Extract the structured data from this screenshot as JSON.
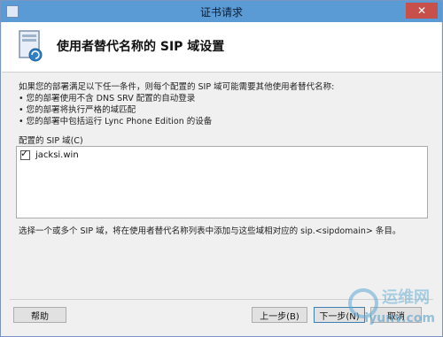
{
  "window": {
    "title": "证书请求",
    "close_label": "✕"
  },
  "header": {
    "title": "使用者替代名称的 SIP 域设置"
  },
  "description": {
    "intro": "如果您的部署满足以下任一条件，则每个配置的 SIP 域可能需要其他使用者替代名称:",
    "bullets": [
      "• 您的部署使用不含 DNS SRV 配置的自动登录",
      "• 您的部署将执行严格的域匹配",
      "• 您的部署中包括运行 Lync Phone Edition 的设备"
    ]
  },
  "sip_section": {
    "label": "配置的 SIP 域(C)",
    "items": [
      {
        "name": "jacksi.win",
        "checked": true
      }
    ]
  },
  "hint": "选择一个或多个 SIP 域，将在使用者替代名称列表中添加与这些域相对应的 sip.<sipdomain> 条目。",
  "buttons": {
    "help": "帮助",
    "back": "上一步(B)",
    "next": "下一步(N)",
    "cancel": "取消"
  },
  "watermark": {
    "cn": "运维网",
    "en": "iyunv.com"
  },
  "colors": {
    "titlebar": "#5b9bd5",
    "close": "#c7504a",
    "accent_border": "#3c7fb1"
  }
}
